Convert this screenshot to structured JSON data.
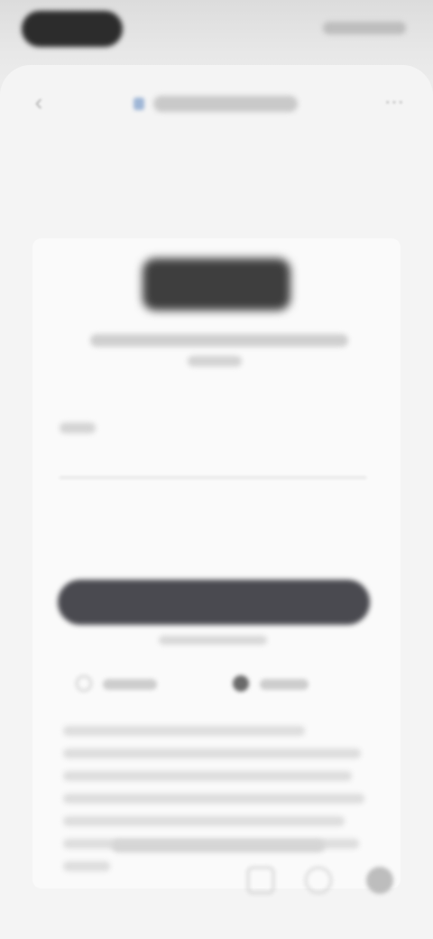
{
  "status_bar": {},
  "browser": {
    "back_glyph": "‹",
    "menu_glyph": "⋯",
    "url": ""
  },
  "card": {
    "logo": "",
    "subtitle": "",
    "field_placeholder": "",
    "primary_button": "",
    "options": [
      {
        "label": "",
        "icon": "radio-icon"
      },
      {
        "label": "",
        "icon": "avatar-icon"
      }
    ]
  },
  "footer": {
    "link": ""
  },
  "toolbar": {
    "icons": [
      "tabs-icon",
      "share-icon",
      "profile-icon"
    ]
  },
  "colors": {
    "primary_button": "#4a4a50",
    "logo": "#3e3e3e",
    "background": "#f4f4f4"
  }
}
